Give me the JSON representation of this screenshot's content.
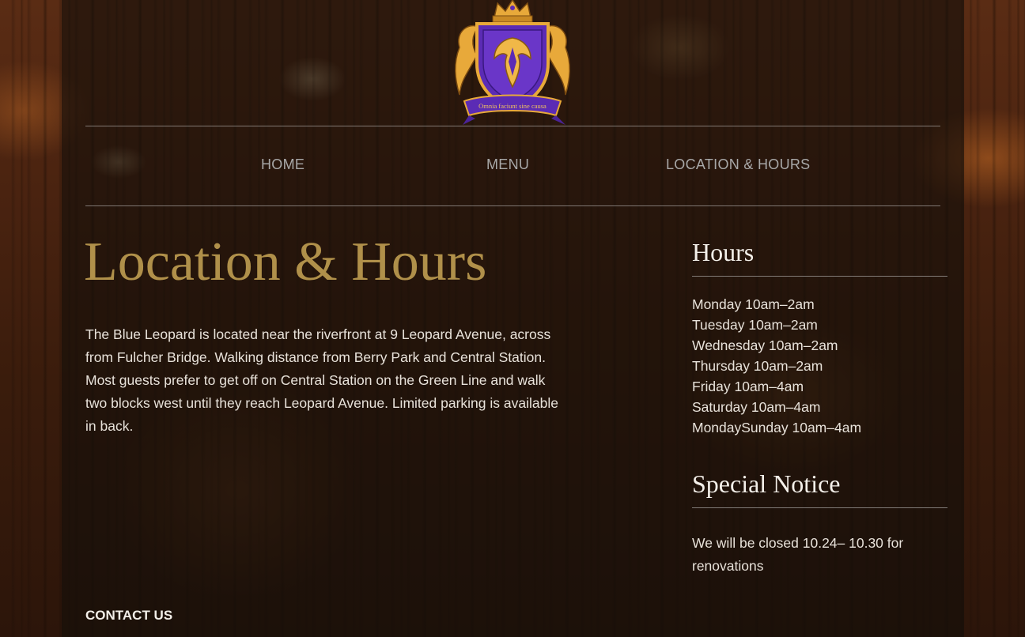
{
  "logo": {
    "motto": "Omnia faciunt sine causa"
  },
  "nav": {
    "items": [
      {
        "label": "HOME"
      },
      {
        "label": "MENU"
      },
      {
        "label": "LOCATION & HOURS"
      }
    ]
  },
  "main": {
    "title": "Location & Hours",
    "intro": "The Blue Leopard is located near the riverfront at 9 Leopard Avenue, across from Fulcher Bridge. Walking distance from Berry Park and Central Station. Most guests prefer to get off on Central Station on the Green Line and walk two blocks west until they reach Leopard Avenue. Limited parking is available in back.",
    "contact_label": "CONTACT US"
  },
  "sidebar": {
    "hours_heading": "Hours",
    "hours": [
      "Monday 10am–2am",
      "Tuesday 10am–2am",
      "Wednesday 10am–2am",
      "Thursday 10am–2am",
      "Friday 10am–4am",
      "Saturday 10am–4am",
      "MondaySunday 10am–4am"
    ],
    "notice_heading": "Special Notice",
    "notice_text": "We will be closed 10.24– 10.30 for renovations"
  },
  "colors": {
    "title_gold": "#b0904a",
    "nav_gray": "#a8a8a8",
    "crest_purple": "#5b2bb5",
    "crest_gold": "#e8a93a"
  }
}
